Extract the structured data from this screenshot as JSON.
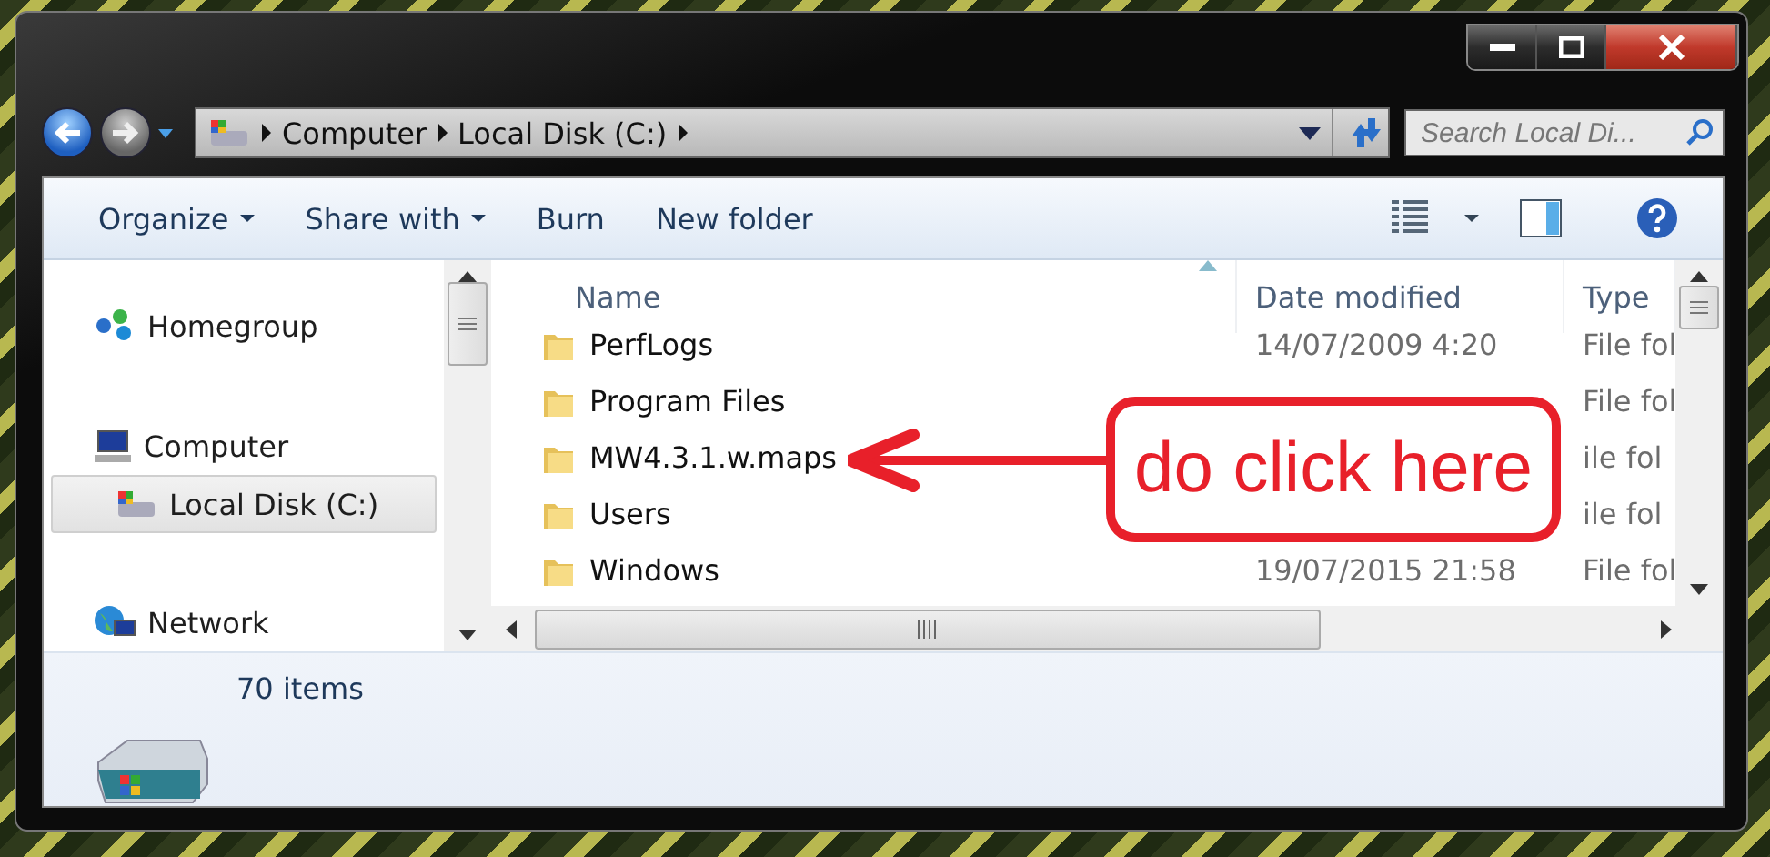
{
  "address": {
    "breadcrumbs": [
      "Computer",
      "Local Disk (C:)"
    ]
  },
  "search": {
    "placeholder": "Search Local Di..."
  },
  "toolbar": [
    {
      "label": "Organize",
      "kind": "menu"
    },
    {
      "label": "Share with",
      "kind": "menu"
    },
    {
      "label": "Burn",
      "kind": "button"
    },
    {
      "label": "New folder",
      "kind": "button"
    }
  ],
  "sidebar": {
    "items": [
      {
        "label": "Homegroup",
        "kind": "homegroup",
        "selected": false
      },
      {
        "label": "Computer",
        "kind": "computer",
        "selected": false,
        "children": [
          {
            "label": "Local Disk (C:)",
            "kind": "drive",
            "selected": true
          }
        ]
      },
      {
        "label": "Network",
        "kind": "network",
        "selected": false
      }
    ]
  },
  "table": {
    "columns": [
      {
        "label": "Name",
        "sorted": true
      },
      {
        "label": "Date modified",
        "sorted": false
      },
      {
        "label": "Type",
        "sorted": false
      }
    ],
    "rows": [
      {
        "name": "PerfLogs",
        "date": "14/07/2009 4:20",
        "type": "File fol"
      },
      {
        "name": "Program Files",
        "type": "File fol"
      },
      {
        "name": "MW4.3.1.w.maps",
        "type": "ile fol"
      },
      {
        "name": "Users",
        "type": "ile fol"
      },
      {
        "name": "Windows",
        "date": "19/07/2015 21:58",
        "type": "File fol"
      }
    ]
  },
  "annotation": {
    "text": "do click here"
  },
  "status": {
    "count": "70 items"
  }
}
